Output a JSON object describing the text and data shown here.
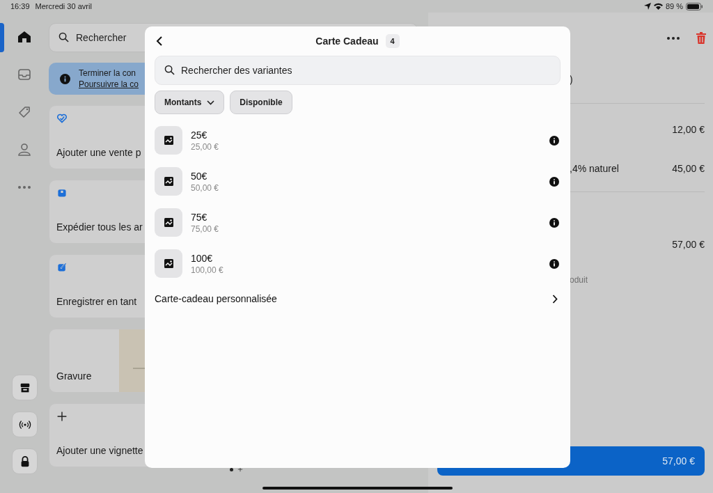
{
  "status_bar": {
    "time": "16:39",
    "date": "Mercredi 30 avril",
    "battery": "89 %"
  },
  "nav_rail": {
    "items": [
      {
        "kind": "home",
        "selected": true
      },
      {
        "kind": "inbox",
        "selected": false
      },
      {
        "kind": "tag",
        "selected": false
      },
      {
        "kind": "person",
        "selected": false
      },
      {
        "kind": "more",
        "selected": false
      }
    ],
    "buttons": [
      {
        "kind": "store"
      },
      {
        "kind": "broadcast"
      },
      {
        "kind": "lock"
      }
    ]
  },
  "search": {
    "placeholder": "Rechercher"
  },
  "banner": {
    "lines": [
      "Terminer la con",
      "Poursuivre la co"
    ]
  },
  "tiles": [
    {
      "kind": "heart",
      "label": "Ajouter une vente p"
    },
    {
      "kind": "box",
      "label": "Expédier tous les ar"
    },
    {
      "kind": "edit",
      "label": "Enregistrer en tant"
    },
    {
      "kind": "picture",
      "label": "Gravure"
    },
    {
      "kind": "add",
      "label": "Ajouter une vignette"
    }
  ],
  "page_dots": [
    {
      "kind": "dot"
    },
    {
      "kind": "add"
    }
  ],
  "cart": {
    "title_tail": ")",
    "lines": [
      {
        "amount": "12,00 €"
      },
      {
        "label": ",4% naturel",
        "amount": "45,00 €"
      }
    ],
    "total": "57,00 €",
    "note": "oduit",
    "checkout": "57,00 €"
  },
  "modal": {
    "title": "Carte Cadeau",
    "count": "4",
    "search": {
      "placeholder": "Rechercher des variantes"
    },
    "filters": [
      {
        "label": "Montants",
        "dropdown": true
      },
      {
        "label": "Disponible",
        "dropdown": false
      }
    ],
    "variants": [
      {
        "name": "25€",
        "price": "25,00 €"
      },
      {
        "name": "50€",
        "price": "50,00 €"
      },
      {
        "name": "75€",
        "price": "75,00 €"
      },
      {
        "name": "100€",
        "price": "100,00 €"
      }
    ],
    "custom": "Carte-cadeau personnalisée"
  }
}
